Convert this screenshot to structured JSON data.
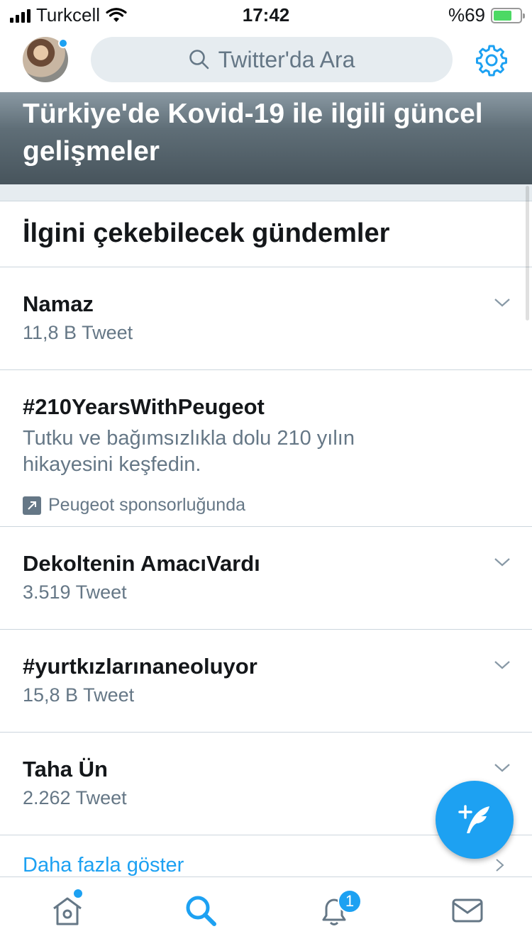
{
  "status_bar": {
    "carrier": "Turkcell",
    "time": "17:42",
    "battery": "%69"
  },
  "header": {
    "search_placeholder": "Twitter'da Ara"
  },
  "hero": {
    "title": "Türkiye'de Kovid-19 ile ilgili güncel gelişmeler"
  },
  "section": {
    "title": "İlgini çekebilecek gündemler"
  },
  "trends": [
    {
      "name": "Namaz",
      "meta": "11,8 B Tweet"
    },
    {
      "name": "#210YearsWithPeugeot",
      "description": "Tutku ve bağımsızlıkla dolu 210 yılın hikayesini keşfedin.",
      "sponsor": "Peugeot sponsorluğunda"
    },
    {
      "name": "Dekoltenin AmacıVardı",
      "meta": "3.519 Tweet"
    },
    {
      "name": "#yurtkızlarınaneoluyor",
      "meta": "15,8 B Tweet"
    },
    {
      "name": "Taha Ün",
      "meta": "2.262 Tweet"
    }
  ],
  "more_link": "Daha fazla göster",
  "tabbar": {
    "notifications_badge": "1"
  },
  "colors": {
    "accent": "#1da1f2",
    "muted": "#657786",
    "separator": "#e6ecf0"
  },
  "icons": [
    "search-icon",
    "gear-icon",
    "chevron-down-icon",
    "promoted-icon",
    "chevron-right-icon",
    "compose-tweet-icon",
    "home-icon",
    "explore-icon",
    "notifications-icon",
    "messages-icon"
  ]
}
